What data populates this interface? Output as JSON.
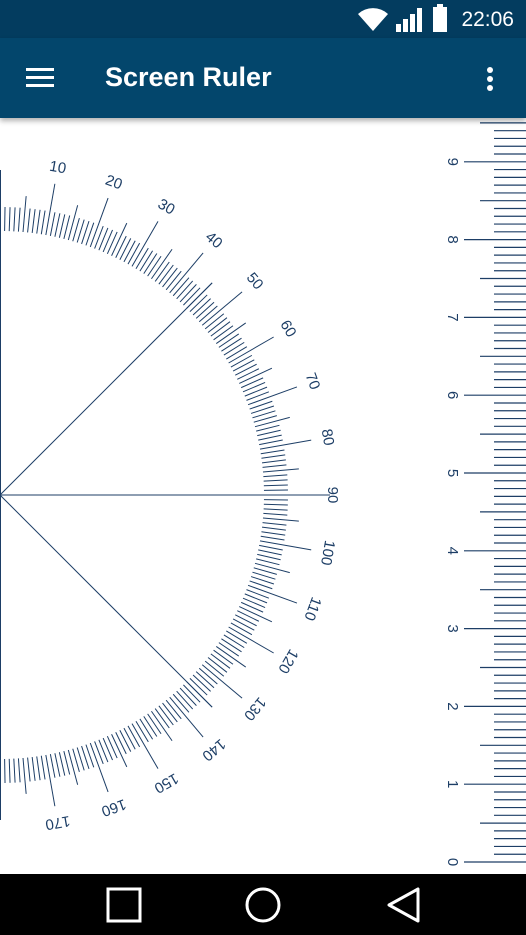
{
  "status_bar": {
    "time": "22:06",
    "icons": [
      "wifi-icon",
      "signal-icon",
      "battery-icon"
    ]
  },
  "app_bar": {
    "title": "Screen Ruler",
    "menu_icon": "hamburger-menu-icon",
    "overflow_icon": "more-vert-icon"
  },
  "protractor": {
    "labels": [
      "10",
      "20",
      "30",
      "40",
      "50",
      "60",
      "70",
      "80",
      "90",
      "100",
      "110",
      "120",
      "130",
      "140",
      "150",
      "160",
      "170"
    ],
    "guide_angles": [
      45,
      90,
      135
    ]
  },
  "ruler": {
    "unit": "cm",
    "labels": [
      "0",
      "1",
      "2",
      "3",
      "4",
      "5",
      "6",
      "7",
      "8",
      "9"
    ]
  },
  "nav_bar": {
    "buttons": [
      "recents-square-icon",
      "home-circle-icon",
      "back-triangle-icon"
    ]
  },
  "colors": {
    "primary": "#03466c",
    "status": "#033c5f",
    "ink": "#1d3e66",
    "background": "#ffffff"
  }
}
